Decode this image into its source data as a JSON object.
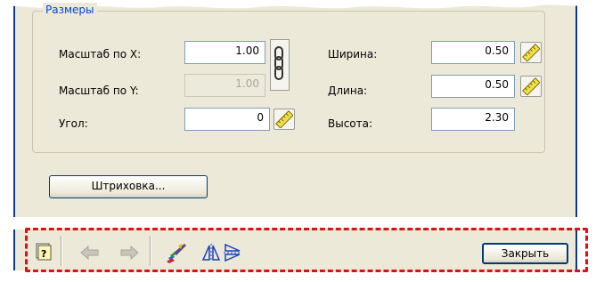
{
  "group": {
    "title": "Размеры"
  },
  "fields": {
    "scale_x": {
      "label": "Масштаб по X:",
      "value": "1.00"
    },
    "scale_y": {
      "label": "Масштаб по Y:",
      "value": "1.00"
    },
    "angle": {
      "label": "Угол:",
      "value": "0"
    },
    "width": {
      "label": "Ширина:",
      "value": "0.50"
    },
    "length": {
      "label": "Длина:",
      "value": "0.50"
    },
    "height": {
      "label": "Высота:",
      "value": "2.30"
    }
  },
  "buttons": {
    "hatch": "Штриховка...",
    "close": "Закрыть"
  },
  "colors": {
    "accent": "#0046d5",
    "highlight": "#e01010",
    "panel": "#ece9d8"
  }
}
